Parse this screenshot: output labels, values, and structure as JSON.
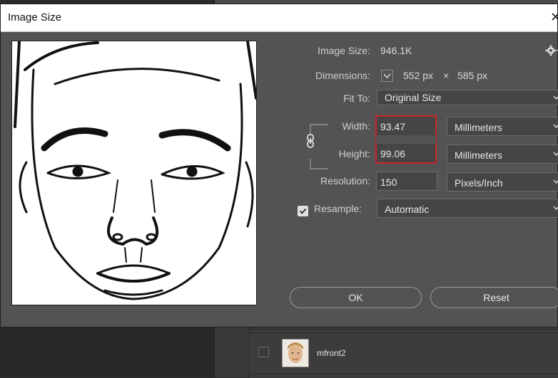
{
  "background": {
    "layers": [
      {
        "name": "mfront2"
      }
    ]
  },
  "dialog": {
    "title": "Image Size",
    "close_glyph": "✕",
    "image_size_label": "Image Size:",
    "image_size_value": "946.1K",
    "settings_icon": "gear-icon",
    "dimensions_label": "Dimensions:",
    "dimensions_width": "552 px",
    "dimensions_times": "×",
    "dimensions_height": "585 px",
    "fit_to_label": "Fit To:",
    "fit_to_value": "Original Size",
    "width_label": "Width:",
    "width_value": "93.47",
    "width_unit": "Millimeters",
    "height_label": "Height:",
    "height_value": "99.06",
    "height_unit": "Millimeters",
    "resolution_label": "Resolution:",
    "resolution_value": "150",
    "resolution_unit": "Pixels/Inch",
    "resample_label": "Resample:",
    "resample_checked": true,
    "resample_value": "Automatic",
    "ok_label": "OK",
    "reset_label": "Reset",
    "highlight_color": "#c8242b"
  }
}
